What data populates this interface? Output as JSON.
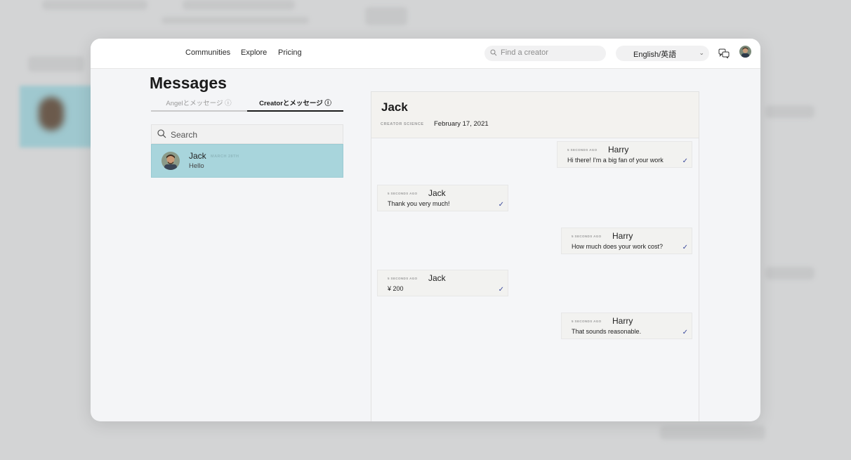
{
  "nav": {
    "links": [
      "Communities",
      "Explore",
      "Pricing"
    ],
    "search_placeholder": "Find a creator",
    "language": "English/英語"
  },
  "page": {
    "title": "Messages",
    "tabs": [
      {
        "label": "Angelとメッセージ ⓘ",
        "active": false
      },
      {
        "label": "Creatorとメッセージ ⓘ",
        "active": true
      }
    ]
  },
  "conversation_list": {
    "search_placeholder": "Search",
    "items": [
      {
        "name": "Jack",
        "date": "MARCH 28TH",
        "preview": "Hello",
        "selected": true
      }
    ]
  },
  "chat": {
    "title": "Jack",
    "tag": "CREATOR SCIENCE",
    "date": "February 17, 2021",
    "messages": [
      {
        "time": "5 SECONDS AGO",
        "sender": "Harry",
        "text": "Hi there! I'm a big fan of your work",
        "side": "right",
        "check": "✓"
      },
      {
        "time": "5 SECONDS AGO",
        "sender": "Jack",
        "text": "Thank you very much!",
        "side": "left",
        "check": "✓"
      },
      {
        "time": "5 SECONDS AGO",
        "sender": "Harry",
        "text": "How much does your work cost?",
        "side": "right",
        "check": "✓"
      },
      {
        "time": "5 SECONDS AGO",
        "sender": "Jack",
        "text": "¥ 200",
        "side": "left",
        "check": "✓"
      },
      {
        "time": "5 SECONDS AGO",
        "sender": "Harry",
        "text": "That sounds reasonable.",
        "side": "right",
        "check": "✓"
      }
    ]
  },
  "colors": {
    "selected_conversation": "#a8d5dc",
    "check_mark": "#3c4a9c"
  }
}
